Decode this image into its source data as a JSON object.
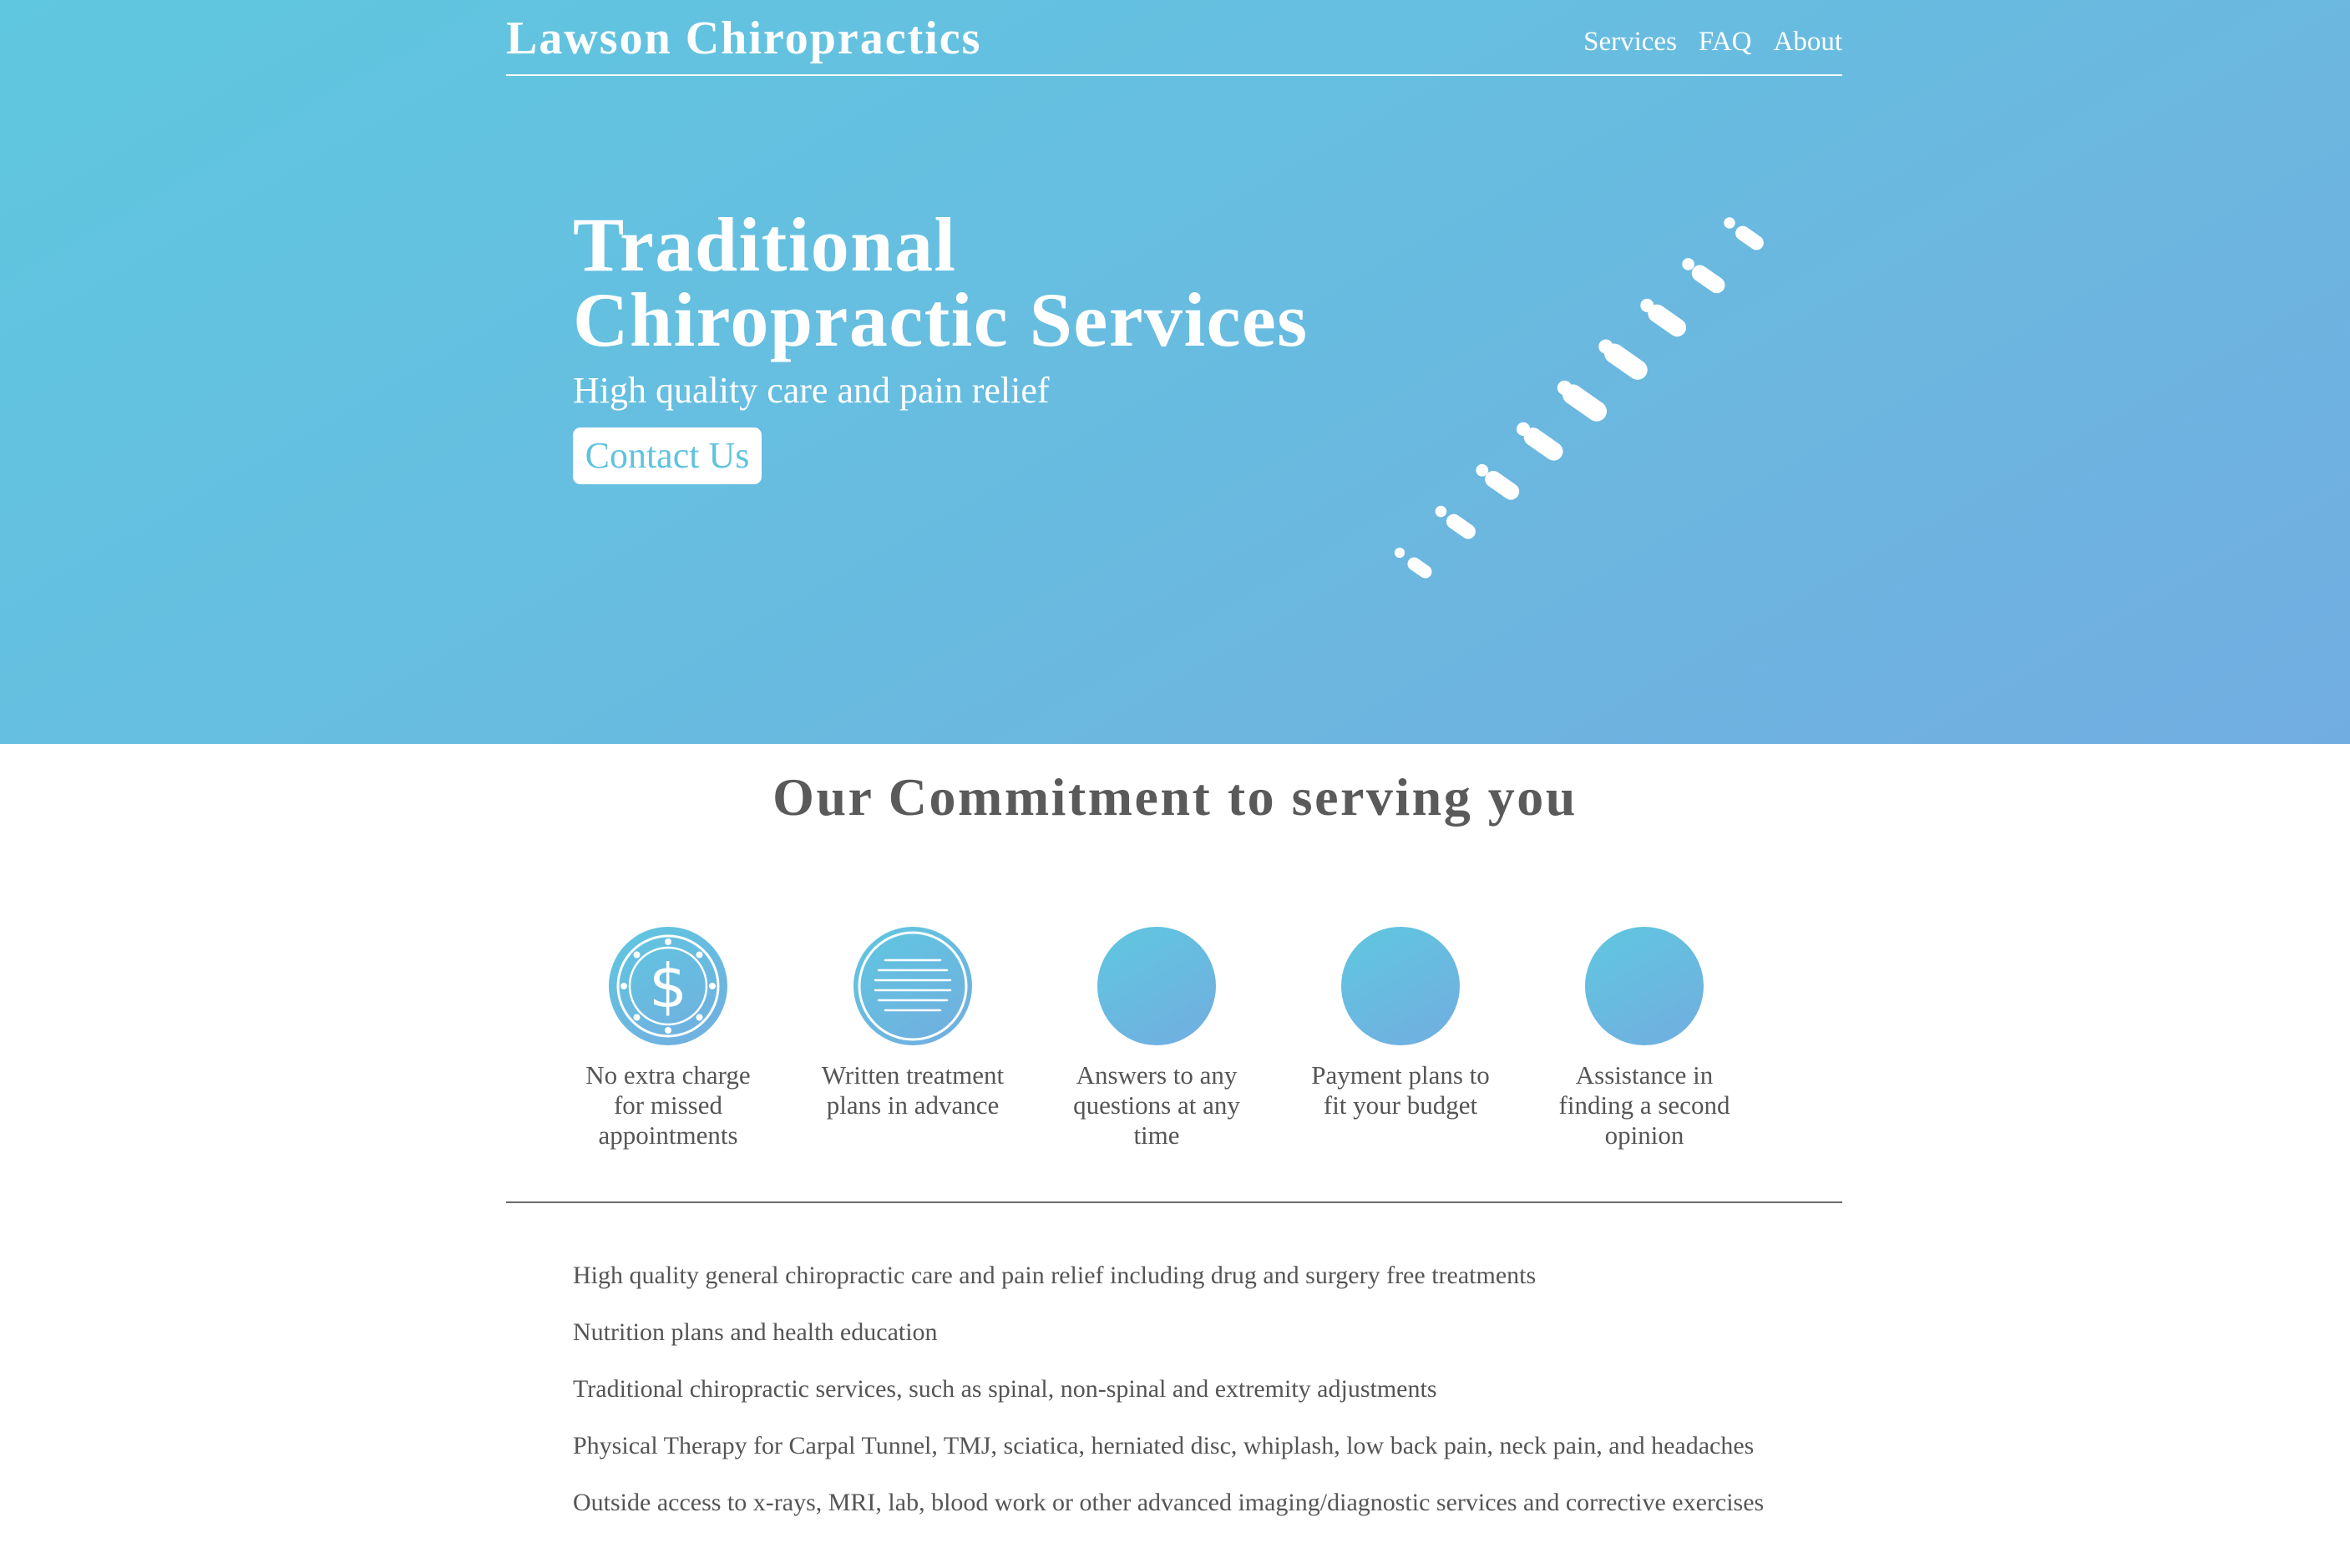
{
  "colors": {
    "hero_gradient_start": "#5fc7df",
    "hero_gradient_end": "#72ade1",
    "button_text": "#5fc3de",
    "body_text": "#555555"
  },
  "header": {
    "brand": "Lawson Chiropractics",
    "nav": [
      {
        "label": "Services"
      },
      {
        "label": "FAQ"
      },
      {
        "label": "About"
      }
    ]
  },
  "hero": {
    "title_line1": "Traditional",
    "title_line2": "Chiropractic Services",
    "subtitle": "High quality care and pain relief",
    "cta_label": "Contact Us",
    "illustration_icon": "spine-icon"
  },
  "commitment": {
    "title": "Our Commitment to serving you",
    "items": [
      {
        "icon": "dollar-coin-icon",
        "label": "No extra charge for missed appointments"
      },
      {
        "icon": "document-lines-icon",
        "label": "Written treatment plans in advance"
      },
      {
        "icon": "blank-circle-icon",
        "label": "Answers to any questions at any time"
      },
      {
        "icon": "blank-circle-icon",
        "label": "Payment plans to fit your budget"
      },
      {
        "icon": "blank-circle-icon",
        "label": "Assistance in finding a second opinion"
      }
    ]
  },
  "services": [
    "High quality general chiropractic care and pain relief including drug and surgery free treatments",
    "Nutrition plans and health education",
    "Traditional chiropractic services, such as spinal, non-spinal and extremity adjustments",
    "Physical Therapy for Carpal Tunnel, TMJ, sciatica, herniated disc, whiplash, low back pain, neck pain, and headaches",
    "Outside access to x-rays, MRI, lab, blood work or other advanced imaging/diagnostic services and corrective exercises"
  ]
}
